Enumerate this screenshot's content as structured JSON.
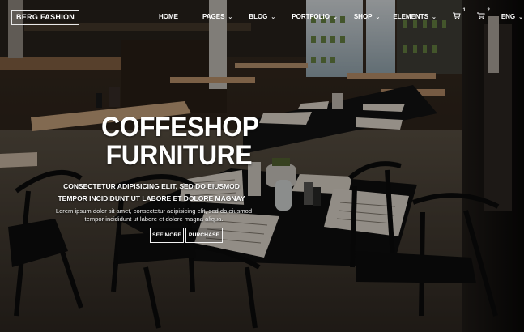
{
  "brand": {
    "logo_text": "BERG FASHION"
  },
  "nav": {
    "items": [
      {
        "label": "HOME",
        "has_dropdown": false
      },
      {
        "label": "PAGES",
        "has_dropdown": true
      },
      {
        "label": "BLOG",
        "has_dropdown": true
      },
      {
        "label": "PORTFOLIO",
        "has_dropdown": true
      },
      {
        "label": "SHOP",
        "has_dropdown": true
      },
      {
        "label": "ELEMENTS",
        "has_dropdown": true
      }
    ],
    "cart_icons": [
      {
        "icon": "cart-icon",
        "badge": "1"
      },
      {
        "icon": "cart-icon",
        "badge": "2"
      }
    ],
    "language": {
      "label": "ENG",
      "has_dropdown": true
    },
    "search": {
      "icon": "search-icon"
    }
  },
  "hero": {
    "title_line1": "COFFESHOP",
    "title_line2": "FURNITURE",
    "subtitle": "CONSECTETUR ADIPISICING ELIT, SED DO EIUSMOD TEMPOR INCIDIDUNT UT LABORE ET DOLORE MAGNAY",
    "body": "Lorem ipsum dolor sit amet, consectetur adipisicing elit, sed do eiusmod tempor incididunt ut labore et dolore magna aliqua.",
    "buttons": {
      "see_more": "SEE MORE",
      "purchase": "PURCHASE"
    }
  },
  "colors": {
    "text": "#ffffff",
    "dark_overlay": "#000000",
    "wood": "#a87f58",
    "table_black": "#171717",
    "menu_paper": "#efe8df"
  }
}
